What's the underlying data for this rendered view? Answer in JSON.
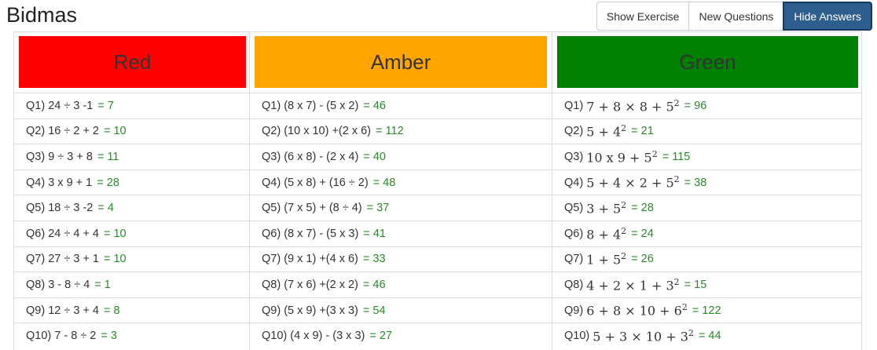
{
  "page": {
    "title": "Bidmas"
  },
  "toolbar": {
    "show_exercise": "Show Exercise",
    "new_questions": "New Questions",
    "hide_answers": "Hide Answers"
  },
  "colors": {
    "red": "#ff0000",
    "amber": "#ffa500",
    "green": "#008000",
    "answer": "#2a8a2a",
    "primary": "#2e5e8e"
  },
  "columns": [
    {
      "header": "Red",
      "rows": [
        {
          "label": "Q1)",
          "question": "24 ÷ 3 -1",
          "answer": "= 7"
        },
        {
          "label": "Q2)",
          "question": "16 ÷ 2 + 2",
          "answer": "= 10"
        },
        {
          "label": "Q3)",
          "question": "9 ÷ 3 + 8",
          "answer": "= 11"
        },
        {
          "label": "Q4)",
          "question": "3 x 9 + 1",
          "answer": "= 28"
        },
        {
          "label": "Q5)",
          "question": "18 ÷ 3 -2",
          "answer": "= 4"
        },
        {
          "label": "Q6)",
          "question": "24 ÷ 4 + 4",
          "answer": "= 10"
        },
        {
          "label": "Q7)",
          "question": "27 ÷ 3 + 1",
          "answer": "= 10"
        },
        {
          "label": "Q8)",
          "question": "3 - 8 ÷ 4",
          "answer": "= 1"
        },
        {
          "label": "Q9)",
          "question": "12 ÷ 3 + 4",
          "answer": "= 8"
        },
        {
          "label": "Q10)",
          "question": "7 - 8 ÷ 2",
          "answer": "= 3"
        }
      ]
    },
    {
      "header": "Amber",
      "rows": [
        {
          "label": "Q1)",
          "question": "(8 x 7) - (5 x 2)",
          "answer": "= 46"
        },
        {
          "label": "Q2)",
          "question": "(10 x 10) +(2 x 6)",
          "answer": "= 112"
        },
        {
          "label": "Q3)",
          "question": "(6 x 8) - (2 x 4)",
          "answer": "= 40"
        },
        {
          "label": "Q4)",
          "question": "(5 x 8) + (16 ÷ 2)",
          "answer": "= 48"
        },
        {
          "label": "Q5)",
          "question": "(7 x 5) + (8 ÷ 4)",
          "answer": "= 37"
        },
        {
          "label": "Q6)",
          "question": "(8 x 7) - (5 x 3)",
          "answer": "= 41"
        },
        {
          "label": "Q7)",
          "question": "(9 x 1) +(4 x 6)",
          "answer": "= 33"
        },
        {
          "label": "Q8)",
          "question": "(7 x 6) +(2 x 2)",
          "answer": "= 46"
        },
        {
          "label": "Q9)",
          "question": "(5 x 9) +(3 x 3)",
          "answer": "= 54"
        },
        {
          "label": "Q10)",
          "question": "(4 x 9) - (3 x 3)",
          "answer": "= 27"
        }
      ]
    },
    {
      "header": "Green",
      "rows": [
        {
          "label": "Q1)",
          "question": "7 + 8 × 8 + 5",
          "exp": "2",
          "answer": "= 96"
        },
        {
          "label": "Q2)",
          "question": "5 + 4",
          "exp": "2",
          "answer": "= 21"
        },
        {
          "label": "Q3)",
          "question": "10 x 9 + 5",
          "exp": "2",
          "answer": "= 115"
        },
        {
          "label": "Q4)",
          "question": "5 + 4 × 2 + 5",
          "exp": "2",
          "answer": "= 38"
        },
        {
          "label": "Q5)",
          "question": "3 + 5",
          "exp": "2",
          "answer": "= 28"
        },
        {
          "label": "Q6)",
          "question": "8 + 4",
          "exp": "2",
          "answer": "= 24"
        },
        {
          "label": "Q7)",
          "question": "1 + 5",
          "exp": "2",
          "answer": "= 26"
        },
        {
          "label": "Q8)",
          "question": "4 + 2 × 1 + 3",
          "exp": "2",
          "answer": "= 15"
        },
        {
          "label": "Q9)",
          "question": "6 + 8 × 10 + 6",
          "exp": "2",
          "answer": "= 122"
        },
        {
          "label": "Q10)",
          "question": "5 + 3 × 10 + 3",
          "exp": "2",
          "answer": "= 44"
        }
      ]
    }
  ]
}
